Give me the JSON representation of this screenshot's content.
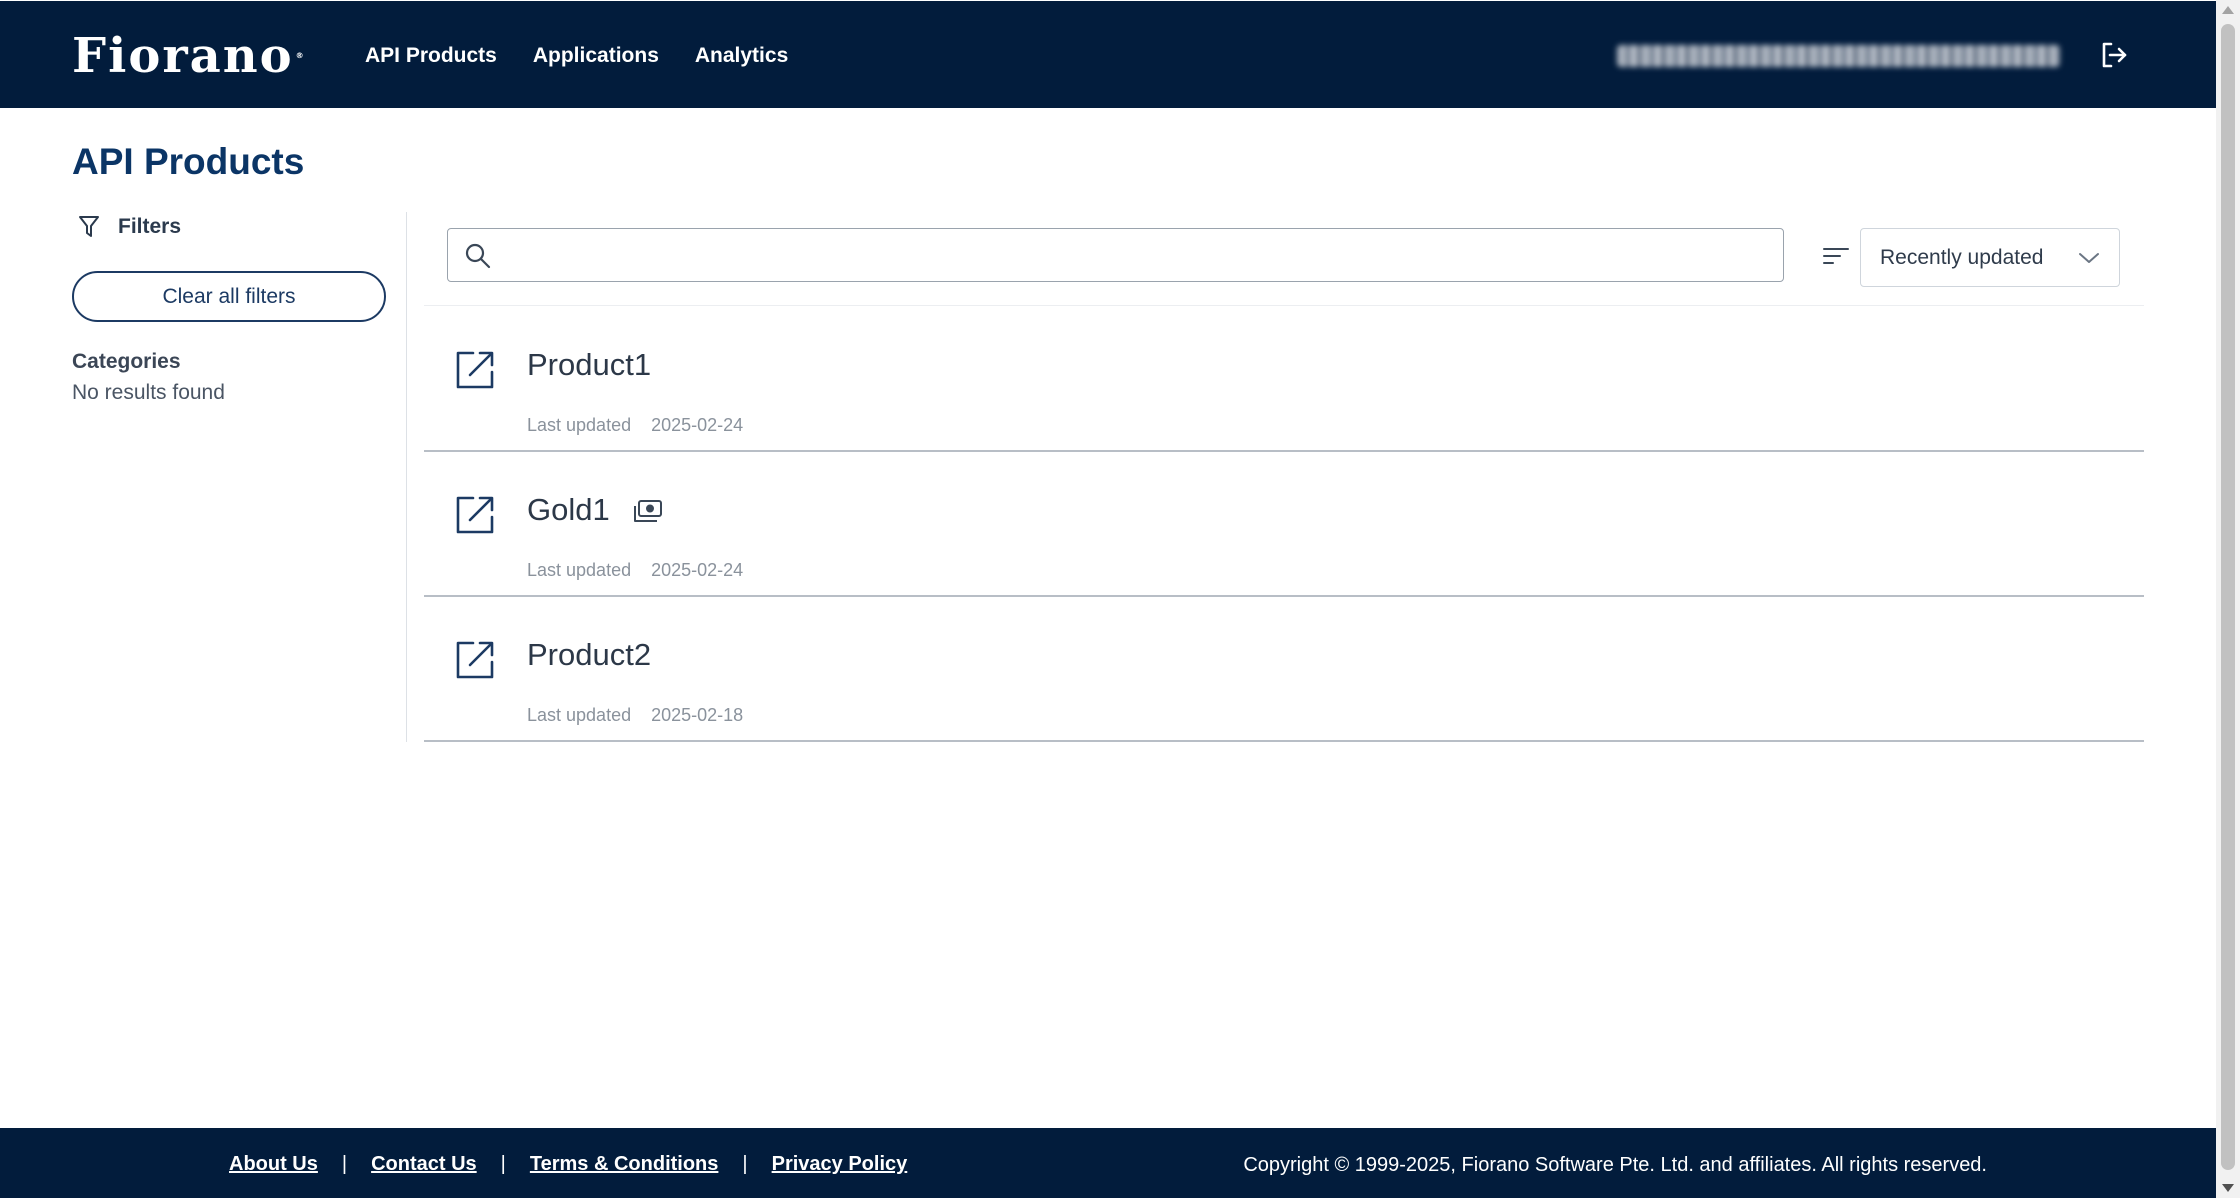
{
  "header": {
    "logo_text": "Fiorano",
    "nav": [
      {
        "label": "API Products"
      },
      {
        "label": "Applications"
      },
      {
        "label": "Analytics"
      }
    ]
  },
  "page": {
    "title": "API Products"
  },
  "sidebar": {
    "filters_label": "Filters",
    "clear_button": "Clear all filters",
    "categories_title": "Categories",
    "categories_empty": "No results found"
  },
  "search": {
    "placeholder": "",
    "value": ""
  },
  "sort": {
    "selected": "Recently updated"
  },
  "products": [
    {
      "name": "Product1",
      "updated_label": "Last updated",
      "updated_date": "2025-02-24",
      "has_plan_icon": false
    },
    {
      "name": "Gold1",
      "updated_label": "Last updated",
      "updated_date": "2025-02-24",
      "has_plan_icon": true
    },
    {
      "name": "Product2",
      "updated_label": "Last updated",
      "updated_date": "2025-02-18",
      "has_plan_icon": false
    }
  ],
  "footer": {
    "links": [
      "About Us",
      "Contact Us",
      "Terms & Conditions",
      "Privacy Policy"
    ],
    "separator": "|",
    "copyright": "Copyright © 1999-2025, Fiorano Software Pte. Ltd. and affiliates. All rights reserved."
  },
  "colors": {
    "header_bg": "#021c3c",
    "title": "#0b3566",
    "accent_border": "#1c3a63"
  },
  "icons": [
    "search-icon",
    "filter-icon",
    "sort-icon",
    "chevron-down-icon",
    "open-external-icon",
    "plan-money-icon",
    "logout-icon"
  ]
}
